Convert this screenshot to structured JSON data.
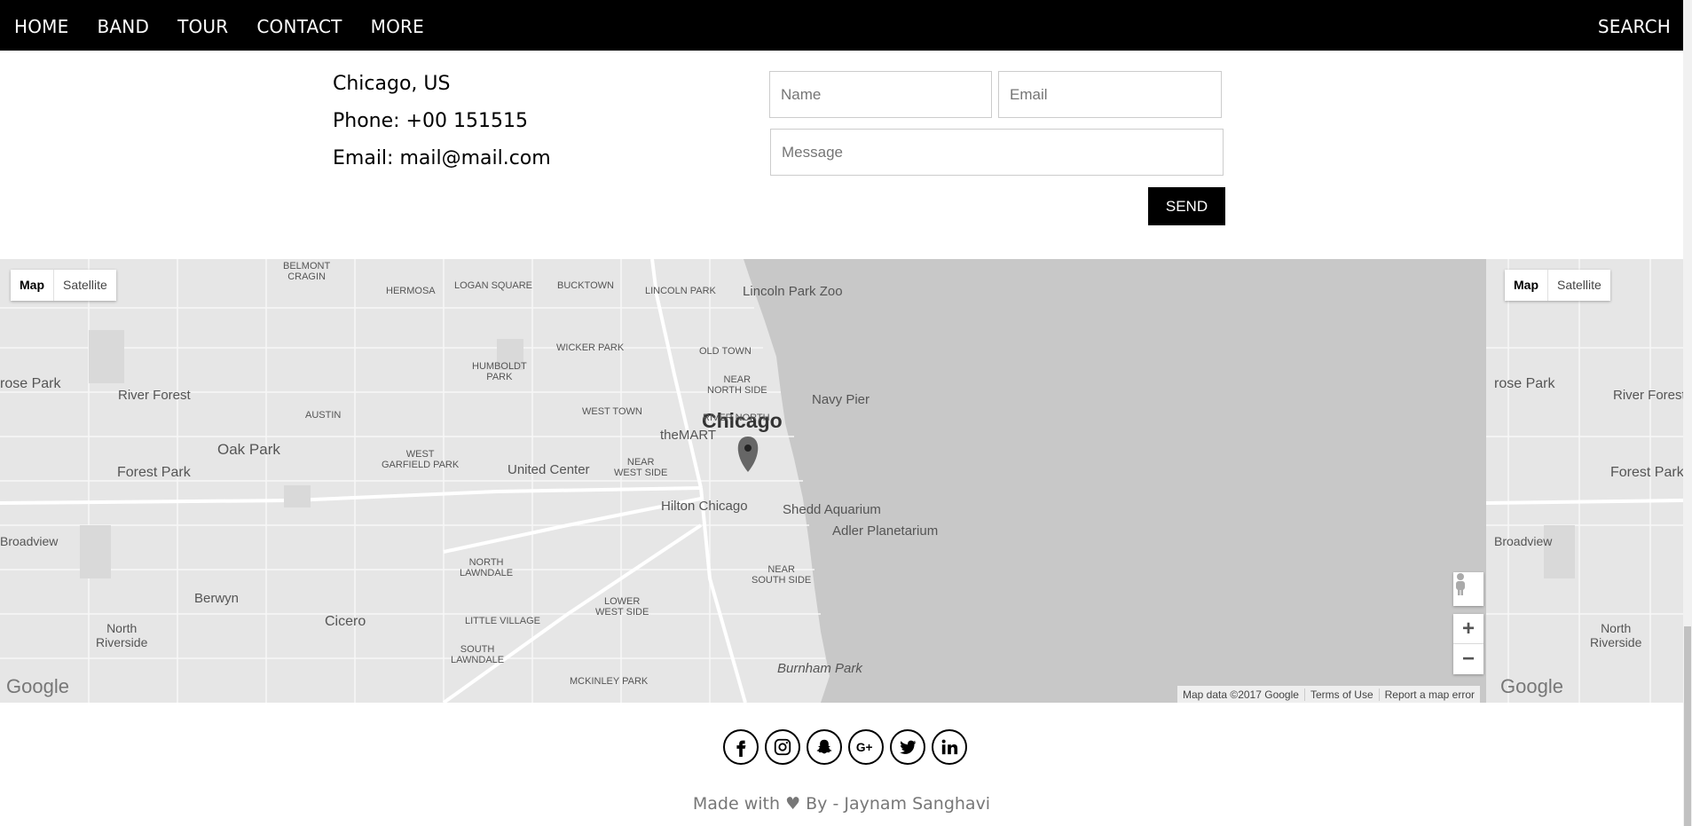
{
  "nav": {
    "items": [
      "HOME",
      "BAND",
      "TOUR",
      "CONTACT",
      "MORE"
    ],
    "search": "SEARCH"
  },
  "contact": {
    "location": "Chicago, US",
    "phone": "Phone: +00 151515",
    "email": "Email: mail@mail.com"
  },
  "form": {
    "name_placeholder": "Name",
    "email_placeholder": "Email",
    "message_placeholder": "Message",
    "send_label": "SEND"
  },
  "map": {
    "type_map": "Map",
    "type_satellite": "Satellite",
    "zoom_in": "+",
    "zoom_out": "−",
    "attribution": [
      "Map data ©2017 Google",
      "Terms of Use",
      "Report a map error"
    ],
    "logo": "Google",
    "labels": {
      "city": "Chicago",
      "lincoln_park_zoo": "Lincoln Park Zoo",
      "navy_pier": "Navy Pier",
      "the_mart": "theMART",
      "united_center": "United Center",
      "hilton_chicago": "Hilton Chicago",
      "shedd": "Shedd Aquarium",
      "adler": "Adler Planetarium",
      "oak_park": "Oak Park",
      "forest_park": "Forest Park",
      "river_forest": "River Forest",
      "cicero": "Cicero",
      "berwyn": "Berwyn",
      "north_riverside": "North\nRiverside",
      "broadview": "Broadview",
      "burnham_park": "Burnham Park",
      "rose_park": "rose Park",
      "austin": "AUSTIN",
      "hermosa": "HERMOSA",
      "logan_square": "LOGAN SQUARE",
      "bucktown": "BUCKTOWN",
      "lincoln_park": "LINCOLN PARK",
      "wicker_park": "WICKER PARK",
      "old_town": "OLD TOWN",
      "humboldt_park": "HUMBOLDT\nPARK",
      "near_north_side": "NEAR\nNORTH SIDE",
      "river_north": "RIVER NORTH",
      "west_town": "WEST TOWN",
      "west_garfield_park": "WEST\nGARFIELD PARK",
      "near_west_side": "NEAR\nWEST SIDE",
      "north_lawndale": "NORTH\nLAWNDALE",
      "lower_west_side": "LOWER\nWEST SIDE",
      "little_village": "LITTLE VILLAGE",
      "south_lawndale": "SOUTH\nLAWNDALE",
      "near_south_side": "NEAR\nSOUTH SIDE",
      "mckinley_park": "MCKINLEY PARK",
      "belmont_cragin": "BELMONT\nCRAGIN"
    }
  },
  "footer": {
    "social": [
      "facebook",
      "instagram",
      "snapchat",
      "google-plus",
      "twitter",
      "linkedin"
    ],
    "credit": "Made with ♥ By - Jaynam Sanghavi"
  },
  "colors": {
    "nav_bg": "#000000",
    "water": "#c8c8c8",
    "land": "#e6e6e6"
  }
}
